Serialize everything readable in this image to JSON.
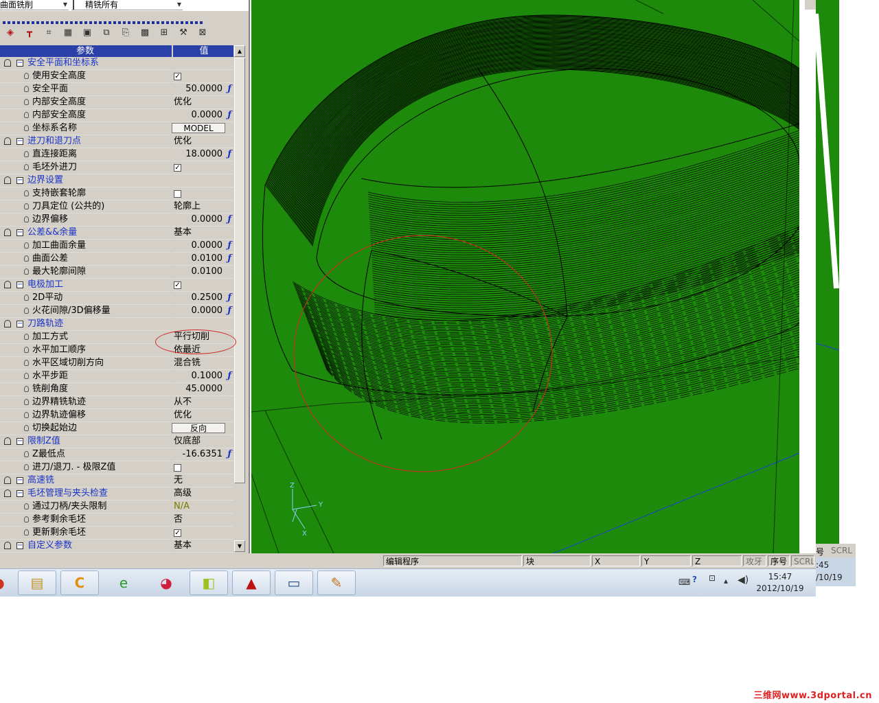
{
  "top_bar": {
    "operation_combo": "曲面铣削",
    "strategy_combo": "精铣所有"
  },
  "toolbar": {
    "icons": [
      "eraser-icon",
      "tool-icon",
      "tool-list-icon",
      "table-icon",
      "window-icon",
      "open-icon",
      "copy-icon",
      "save-icon",
      "stock-icon",
      "settings-icon",
      "run-icon"
    ]
  },
  "grid": {
    "header_param": "参数",
    "header_value": "值"
  },
  "rows": [
    {
      "type": "group",
      "label": "安全平面和坐标系",
      "value": ""
    },
    {
      "type": "item",
      "label": "使用安全高度",
      "value": "",
      "check": "✓"
    },
    {
      "type": "item",
      "label": "安全平面",
      "value": "50.0000",
      "f": "ƒ"
    },
    {
      "type": "item",
      "label": "内部安全高度",
      "value": "优化"
    },
    {
      "type": "item",
      "label": "内部安全高度",
      "value": "0.0000",
      "f": "ƒ"
    },
    {
      "type": "item",
      "label": "坐标系名称",
      "button": "MODEL"
    },
    {
      "type": "group",
      "label": "进刀和退刀点",
      "value": "优化"
    },
    {
      "type": "item",
      "label": "直连接距离",
      "value": "18.0000",
      "f": "ƒ"
    },
    {
      "type": "item",
      "label": "毛坯外进刀",
      "check": "✓"
    },
    {
      "type": "group",
      "label": "边界设置",
      "value": ""
    },
    {
      "type": "item",
      "label": "支持嵌套轮廓",
      "check": ""
    },
    {
      "type": "item",
      "label": "刀具定位 (公共的)",
      "value": "轮廓上"
    },
    {
      "type": "item",
      "label": "边界偏移",
      "value": "0.0000",
      "f": "ƒ"
    },
    {
      "type": "group",
      "label": "公差&&余量",
      "value": "基本"
    },
    {
      "type": "item",
      "label": "加工曲面余量",
      "value": "0.0000",
      "f": "ƒ"
    },
    {
      "type": "item",
      "label": "曲面公差",
      "value": "0.0100",
      "f": "ƒ"
    },
    {
      "type": "item",
      "label": "最大轮廓间隙",
      "value": "0.0100"
    },
    {
      "type": "group",
      "label": "电极加工",
      "check": "✓"
    },
    {
      "type": "item",
      "label": "2D平动",
      "value": "0.2500",
      "f": "ƒ"
    },
    {
      "type": "item",
      "label": "火花间隙/3D偏移量",
      "value": "0.0000",
      "f": "ƒ"
    },
    {
      "type": "group",
      "label": "刀路轨迹",
      "value": ""
    },
    {
      "type": "item",
      "label": "加工方式",
      "value": "平行切削"
    },
    {
      "type": "item",
      "label": "水平加工顺序",
      "value": "依最近"
    },
    {
      "type": "item",
      "label": "水平区域切削方向",
      "value": "混合铣"
    },
    {
      "type": "item",
      "label": "水平步距",
      "value": "0.1000",
      "f": "ƒ"
    },
    {
      "type": "item",
      "label": "铣削角度",
      "value": "45.0000"
    },
    {
      "type": "item",
      "label": "边界精铣轨迹",
      "value": "从不"
    },
    {
      "type": "item",
      "label": "边界轨迹偏移",
      "value": "优化"
    },
    {
      "type": "item",
      "label": "切换起始边",
      "button": "反向"
    },
    {
      "type": "group",
      "label": "限制Z值",
      "value": "仅底部"
    },
    {
      "type": "item",
      "label": "Z最低点",
      "value": "-16.6351",
      "f": "ƒ"
    },
    {
      "type": "item",
      "label": "进刀/退刀. - 极限Z值",
      "check": ""
    },
    {
      "type": "group",
      "label": "高速铣",
      "value": "无"
    },
    {
      "type": "group",
      "label": "毛坯管理与夹头检查",
      "value": "高级"
    },
    {
      "type": "item",
      "label": "通过刀柄/夹头限制",
      "na": "N/A"
    },
    {
      "type": "item",
      "label": "参考剩余毛坯",
      "value": "否"
    },
    {
      "type": "item",
      "label": "更新剩余毛坯",
      "check": "✓"
    },
    {
      "type": "group",
      "label": "自定义参数",
      "value": "基本"
    }
  ],
  "viewport": {
    "axis_labels": {
      "z": "Z",
      "y": "Y",
      "x": "X"
    },
    "colors": {
      "background": "#1d8a0b",
      "toolpath": "#000000",
      "highlight_circle": "#c03020",
      "ground_line": "#1a3fd0"
    }
  },
  "statusbar": {
    "fields": [
      "编辑程序",
      "块",
      "X",
      "Y",
      "Z",
      "攻牙",
      "序号",
      "SCRL"
    ],
    "right_fields": [
      "号",
      "SCRL"
    ]
  },
  "taskbar": {
    "apps": [
      "start-orb-icon",
      "file-explorer-icon",
      "c-app-icon",
      "ie-icon",
      "chrome-like-icon",
      "sticky-notes-icon",
      "acrobat-icon",
      "monitor-app-icon",
      "paint-icon"
    ],
    "time": "15:47",
    "date": "2012/10/19",
    "right_time": ":45",
    "right_date": "/10/19"
  },
  "watermark": "三维网www.3dportal.cn"
}
